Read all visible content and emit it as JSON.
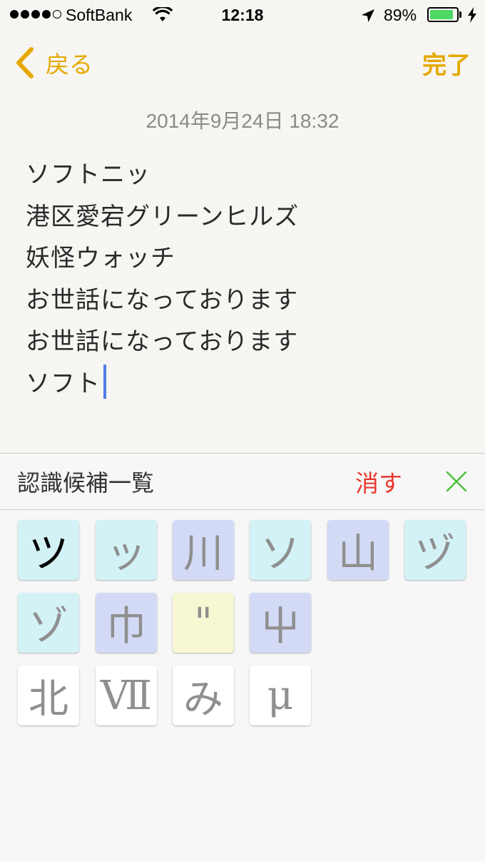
{
  "status_bar": {
    "carrier": "SoftBank",
    "time": "12:18",
    "battery_percent": "89%",
    "battery_level": 0.89,
    "signal_bars_filled": 4,
    "signal_bars_total": 5,
    "icons": [
      "wifi-icon",
      "location-arrow-icon",
      "battery-icon",
      "charging-bolt-icon"
    ]
  },
  "nav": {
    "back_label": "戻る",
    "done_label": "完了",
    "accent_color": "#e6a800"
  },
  "note": {
    "date": "2014年9月24日 18:32",
    "lines": [
      "ソフトニッ",
      "港区愛宕グリーンヒルズ",
      "妖怪ウォッチ",
      "お世話になっております",
      "お世話になっております",
      "ソフト"
    ]
  },
  "handwriting_panel": {
    "title": "認識候補一覧",
    "erase_label": "消す",
    "erase_color": "#e8382e",
    "close_icon_color": "#4cbf3a",
    "candidates": [
      {
        "char": "ツ",
        "color": "cyan"
      },
      {
        "char": "ッ",
        "color": "cyan"
      },
      {
        "char": "川",
        "color": "blue"
      },
      {
        "char": "ソ",
        "color": "cyan"
      },
      {
        "char": "山",
        "color": "blue"
      },
      {
        "char": "ヅ",
        "color": "cyan"
      },
      {
        "char": "ゾ",
        "color": "cyan"
      },
      {
        "char": "巾",
        "color": "blue"
      },
      {
        "char": "\"",
        "color": "yellow"
      },
      {
        "char": "屮",
        "color": "blue"
      },
      {
        "char": "北",
        "color": "white"
      },
      {
        "char": "Ⅶ",
        "color": "white"
      },
      {
        "char": "み",
        "color": "white"
      },
      {
        "char": "μ",
        "color": "white"
      }
    ]
  }
}
